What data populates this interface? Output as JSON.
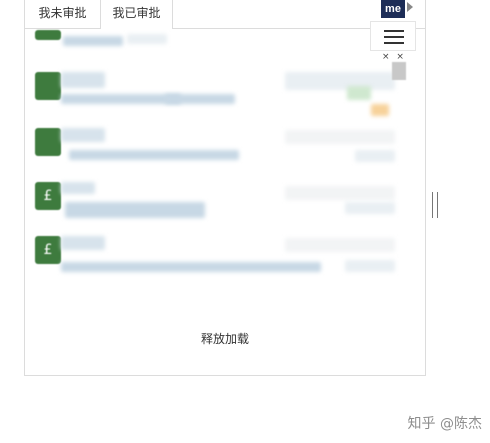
{
  "tabs": [
    {
      "label": "我未审批"
    },
    {
      "label": "我已审批"
    }
  ],
  "list": {
    "avatar_glyphs": [
      "",
      "",
      "",
      "£",
      "£"
    ]
  },
  "load_more": "释放加载",
  "side_toolbar": {
    "logo_text": "me",
    "close_marks": "× ×"
  },
  "watermark": "知乎 @陈杰"
}
